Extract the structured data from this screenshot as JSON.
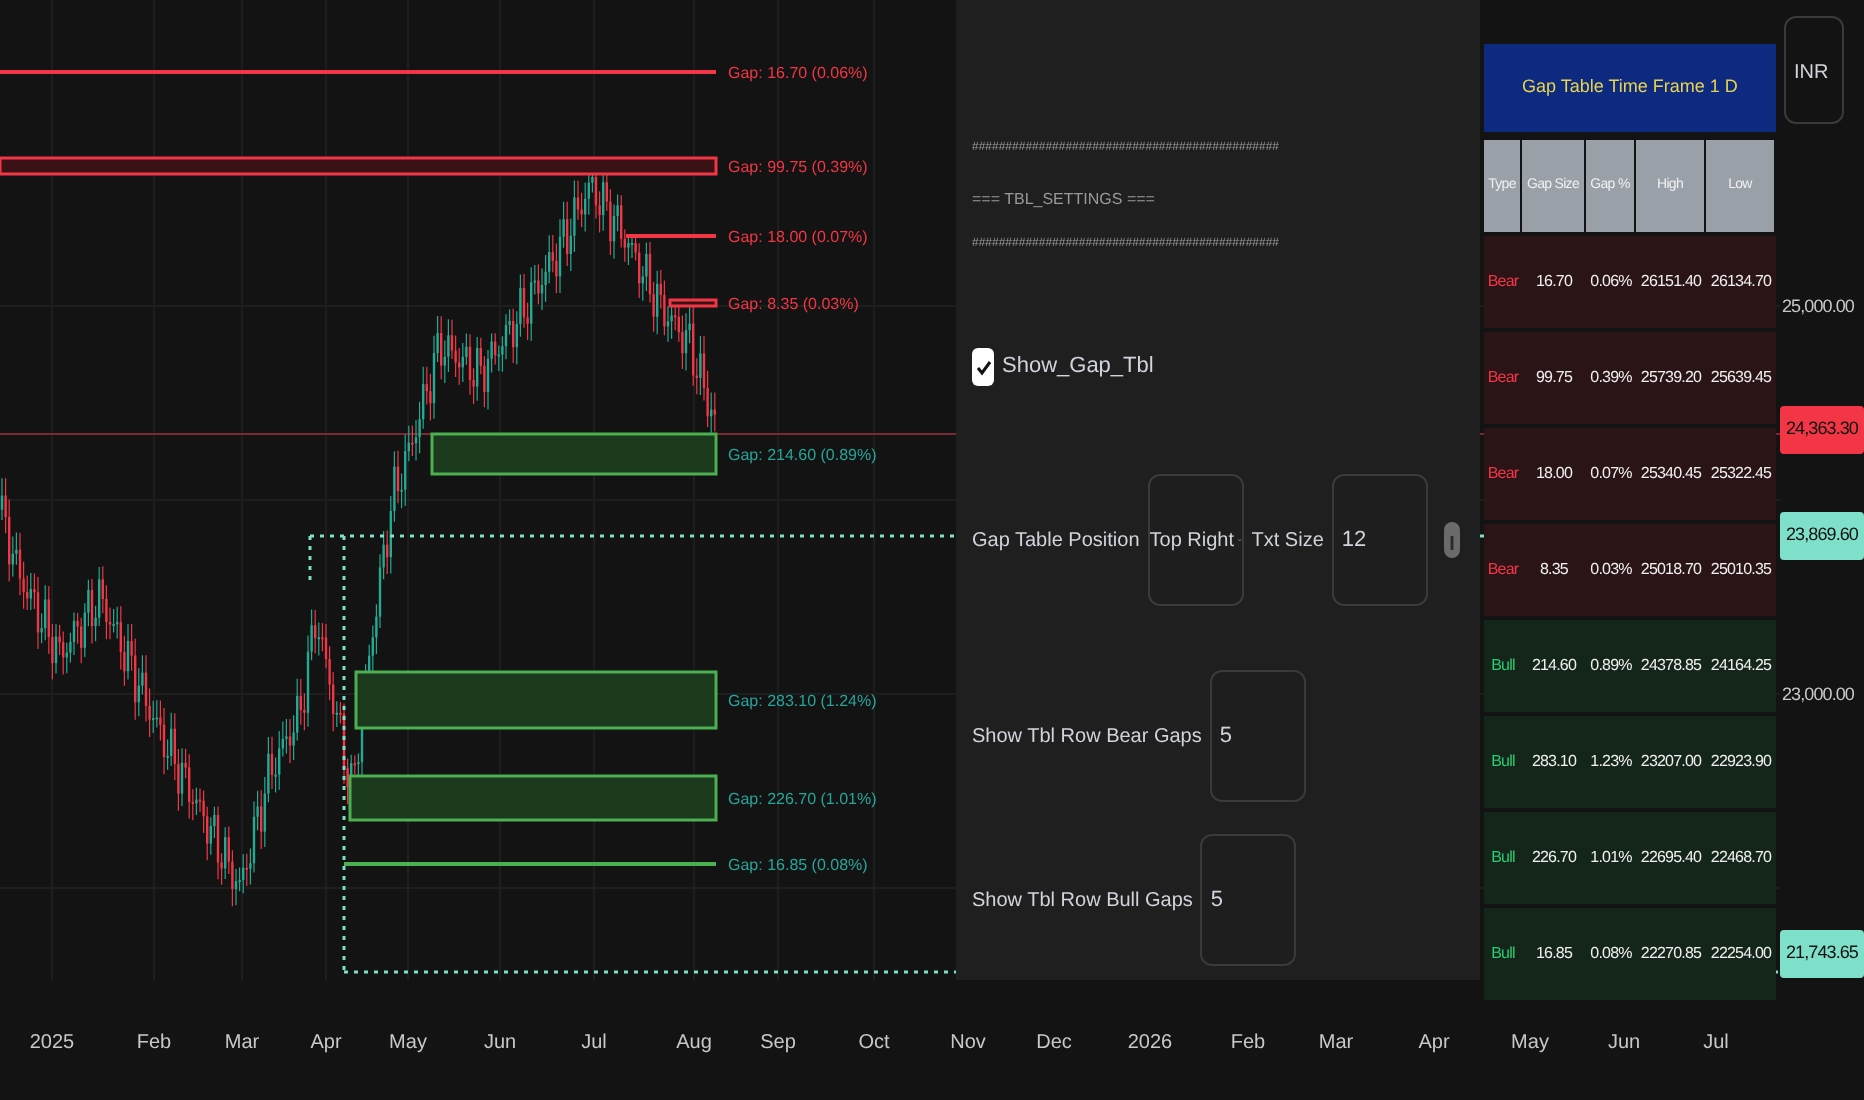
{
  "chart": {
    "gaps": [
      {
        "kind": "bear",
        "label": "Gap: 16.70 (0.06%)"
      },
      {
        "kind": "bear",
        "label": "Gap: 99.75 (0.39%)"
      },
      {
        "kind": "bear",
        "label": "Gap: 18.00 (0.07%)"
      },
      {
        "kind": "bear",
        "label": "Gap: 8.35 (0.03%)"
      },
      {
        "kind": "bull",
        "label": "Gap: 214.60 (0.89%)"
      },
      {
        "kind": "bull",
        "label": "Gap: 283.10 (1.24%)"
      },
      {
        "kind": "bull",
        "label": "Gap: 226.70 (1.01%)"
      },
      {
        "kind": "bull",
        "label": "Gap: 16.85 (0.08%)"
      }
    ]
  },
  "settings": {
    "separator_top": "##############################################",
    "section_title": "=== TBL_SETTINGS ===",
    "separator_bottom": "##############################################",
    "show_table": {
      "label": "Show_Gap_Tbl",
      "checked": true
    },
    "position": {
      "label": "Gap Table Position",
      "value": "Top Right"
    },
    "text_size": {
      "label": "Txt Size",
      "value": "12"
    },
    "bear_rows": {
      "label": "Show Tbl Row Bear Gaps",
      "value": "5"
    },
    "bull_rows": {
      "label": "Show Tbl Row Bull Gaps",
      "value": "5"
    }
  },
  "gap_table": {
    "title": "Gap Table Time Frame 1 D",
    "columns": [
      "Type",
      "Gap Size",
      "Gap %",
      "High",
      "Low"
    ],
    "rows": [
      {
        "kind": "bear",
        "cells": [
          "Bear",
          "16.70",
          "0.06%",
          "26151.40",
          "26134.70"
        ]
      },
      {
        "kind": "bear",
        "cells": [
          "Bear",
          "99.75",
          "0.39%",
          "25739.20",
          "25639.45"
        ]
      },
      {
        "kind": "bear",
        "cells": [
          "Bear",
          "18.00",
          "0.07%",
          "25340.45",
          "25322.45"
        ]
      },
      {
        "kind": "bear",
        "cells": [
          "Bear",
          "8.35",
          "0.03%",
          "25018.70",
          "25010.35"
        ]
      },
      {
        "kind": "bull",
        "cells": [
          "Bull",
          "214.60",
          "0.89%",
          "24378.85",
          "24164.25"
        ]
      },
      {
        "kind": "bull",
        "cells": [
          "Bull",
          "283.10",
          "1.23%",
          "23207.00",
          "22923.90"
        ]
      },
      {
        "kind": "bull",
        "cells": [
          "Bull",
          "226.70",
          "1.01%",
          "22695.40",
          "22468.70"
        ]
      },
      {
        "kind": "bull",
        "cells": [
          "Bull",
          "16.85",
          "0.08%",
          "22270.85",
          "22254.00"
        ]
      }
    ]
  },
  "price_axis": {
    "currency": "INR",
    "labels": [
      {
        "kind": "tick",
        "text": "25,000.00"
      },
      {
        "kind": "badge",
        "text": "24,363.30",
        "color": "#f23645"
      },
      {
        "kind": "badge",
        "text": "23,869.60",
        "color": "#7fe0c9"
      },
      {
        "kind": "tick",
        "text": "23,000.00"
      },
      {
        "kind": "badge",
        "text": "21,743.65",
        "color": "#7fe0c9"
      }
    ]
  },
  "time_axis": [
    "2025",
    "Feb",
    "Mar",
    "Apr",
    "May",
    "Jun",
    "Jul",
    "Aug",
    "Sep",
    "Oct",
    "Nov",
    "Dec",
    "2026",
    "Feb",
    "Mar",
    "Apr",
    "May",
    "Jun",
    "Jul"
  ]
}
